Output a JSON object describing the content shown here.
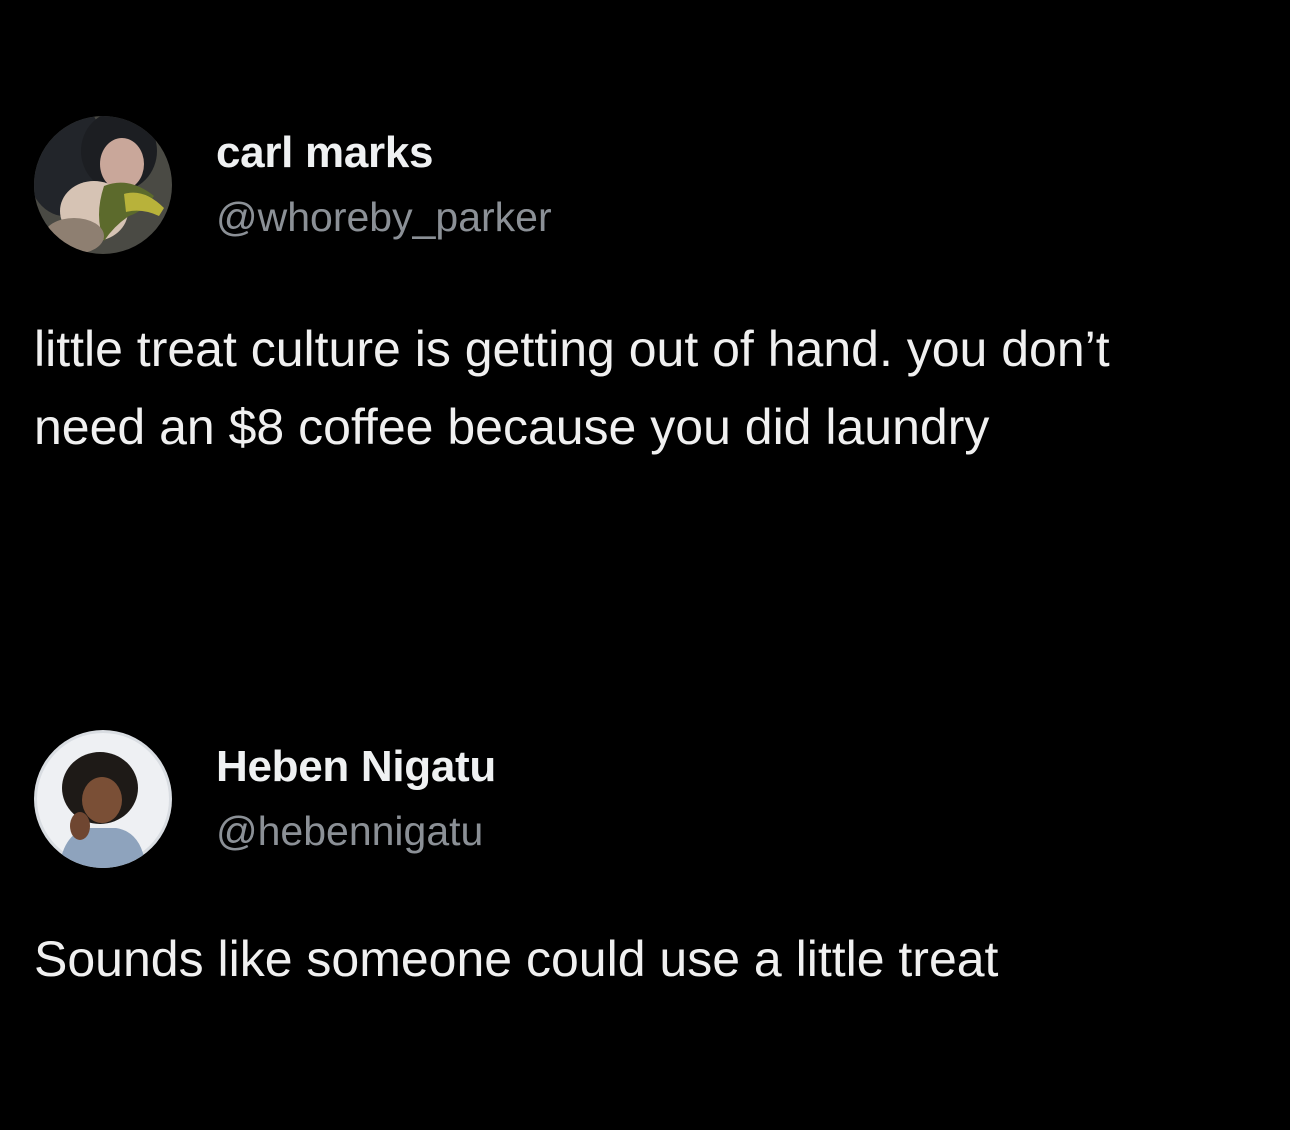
{
  "tweets": [
    {
      "display_name": "carl marks",
      "handle": "@whoreby_parker",
      "avatar": "profile-photo",
      "text": "little treat culture is getting out of hand. you don’t need an $8 coffee because you did laundry"
    },
    {
      "display_name": "Heben Nigatu",
      "handle": "@hebennigatu",
      "avatar": "profile-photo",
      "text": "Sounds like someone could use a little treat"
    }
  ],
  "colors": {
    "background": "#000000",
    "text": "#e7e9ea",
    "handle": "#8b9096"
  }
}
